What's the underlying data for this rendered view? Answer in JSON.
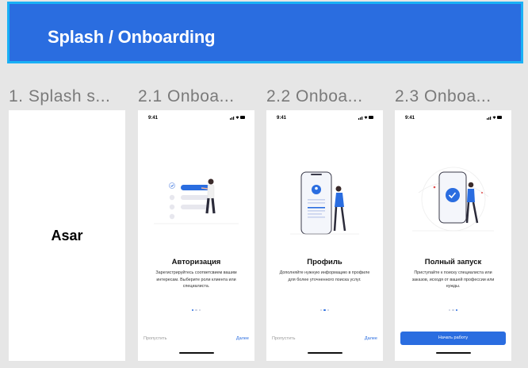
{
  "banner": {
    "title": "Splash / Onboarding"
  },
  "frames": [
    {
      "label": "1. Splash s...",
      "logo": "Asar"
    },
    {
      "label": "2.1  Onboa...",
      "time": "9:41",
      "title": "Авторизация",
      "text": "Зарегистрируйтесь соответсвием вашим интересам. Выберите роли клиента или специалиста.",
      "skip": "Пропустить",
      "next": "Далее"
    },
    {
      "label": "2.2  Onboa...",
      "time": "9:41",
      "title": "Профиль",
      "text": "Дополняйте нужную информацию в профиле для более уточненного поиска услуг.",
      "skip": "Пропустить",
      "next": "Далее"
    },
    {
      "label": "2.3  Onboa...",
      "time": "9:41",
      "title": "Полный запуск",
      "text": "Приступайте к поиску специалиста или заказов, исходя от вашей профессии или нужды.",
      "start": "Начать работу"
    }
  ],
  "colors": {
    "accent": "#2a6de0",
    "banner_border": "#1ab0f5",
    "background": "#e6e6e6"
  }
}
